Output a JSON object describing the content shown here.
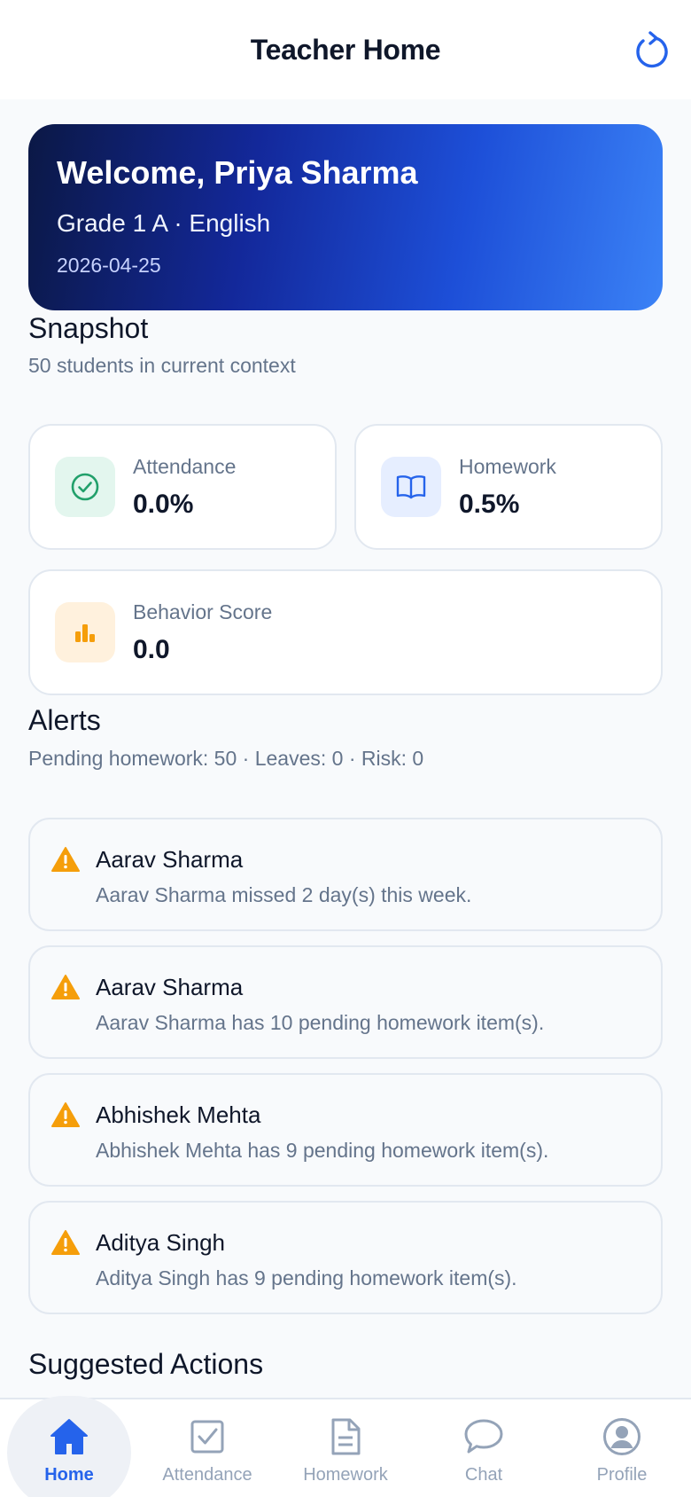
{
  "header": {
    "title": "Teacher Home",
    "refresh_icon": "refresh-icon"
  },
  "welcome": {
    "title": "Welcome, Priya Sharma",
    "subtitle": "Grade 1 A · English",
    "date": "2026-04-25"
  },
  "snapshot": {
    "title": "Snapshot",
    "subtitle": "50 students in current context",
    "stats": [
      {
        "label": "Attendance",
        "value": "0.0%",
        "icon": "check-circle-icon",
        "accent": "#22a06b"
      },
      {
        "label": "Homework",
        "value": "0.5%",
        "icon": "book-icon",
        "accent": "#2563eb"
      },
      {
        "label": "Behavior Score",
        "value": "0.0",
        "icon": "bar-chart-icon",
        "accent": "#f59e0b"
      }
    ]
  },
  "alerts": {
    "title": "Alerts",
    "subtitle": "Pending homework: 50 · Leaves: 0 · Risk: 0",
    "items": [
      {
        "name": "Aarav Sharma",
        "message": "Aarav Sharma missed 2 day(s) this week."
      },
      {
        "name": "Aarav Sharma",
        "message": "Aarav Sharma has 10 pending homework item(s)."
      },
      {
        "name": "Abhishek Mehta",
        "message": "Abhishek Mehta has 9 pending homework item(s)."
      },
      {
        "name": "Aditya Singh",
        "message": "Aditya Singh has 9 pending homework item(s)."
      }
    ]
  },
  "suggested": {
    "title": "Suggested Actions"
  },
  "nav": {
    "items": [
      {
        "label": "Home",
        "icon": "home-icon",
        "active": true
      },
      {
        "label": "Attendance",
        "icon": "checkbox-icon",
        "active": false
      },
      {
        "label": "Homework",
        "icon": "document-icon",
        "active": false
      },
      {
        "label": "Chat",
        "icon": "chat-bubble-icon",
        "active": false
      },
      {
        "label": "Profile",
        "icon": "user-circle-icon",
        "active": false
      }
    ]
  },
  "colors": {
    "brand": "#2563eb",
    "warning": "#f59e0b",
    "success": "#22a06b"
  }
}
